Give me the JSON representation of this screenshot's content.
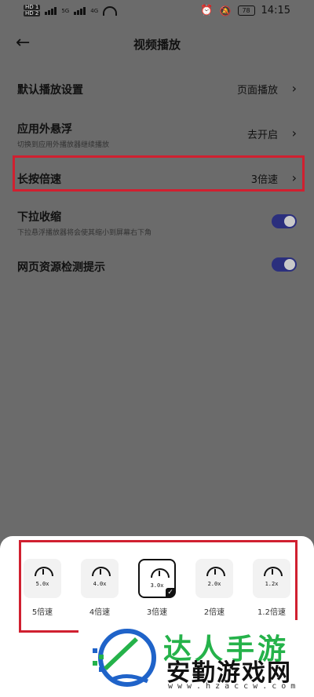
{
  "status": {
    "hd1": "HD 1",
    "hd2": "HD 2",
    "net1": "5G",
    "net2": "4G",
    "battery": "78",
    "time": "14:15"
  },
  "header": {
    "title": "视频播放"
  },
  "settings": [
    {
      "label": "默认播放设置",
      "value": "页面播放"
    },
    {
      "label": "应用外悬浮",
      "sub": "切换到应用外播放器继续播放",
      "value": "去开启"
    },
    {
      "label": "长按倍速",
      "value": "3倍速"
    },
    {
      "label": "下拉收缩",
      "sub": "下拉悬浮播放器将会使其缩小到屏幕右下角",
      "toggle": "on"
    },
    {
      "label": "网页资源检测提示",
      "toggle": "on"
    }
  ],
  "speed_options": [
    {
      "icon_text": "5.0x",
      "label": "5倍速"
    },
    {
      "icon_text": "4.0x",
      "label": "4倍速"
    },
    {
      "icon_text": "3.0x",
      "label": "3倍速",
      "selected": true
    },
    {
      "icon_text": "2.0x",
      "label": "2倍速"
    },
    {
      "icon_text": "1.2x",
      "label": "1.2倍速"
    }
  ],
  "watermark": {
    "line1": "达人手游",
    "line2": "安勤游戏网",
    "url": "www.hzaccw.com"
  },
  "colors": {
    "highlight": "#d02030",
    "toggle_on": "#2b2f7d",
    "watermark_green": "#25b24a"
  }
}
